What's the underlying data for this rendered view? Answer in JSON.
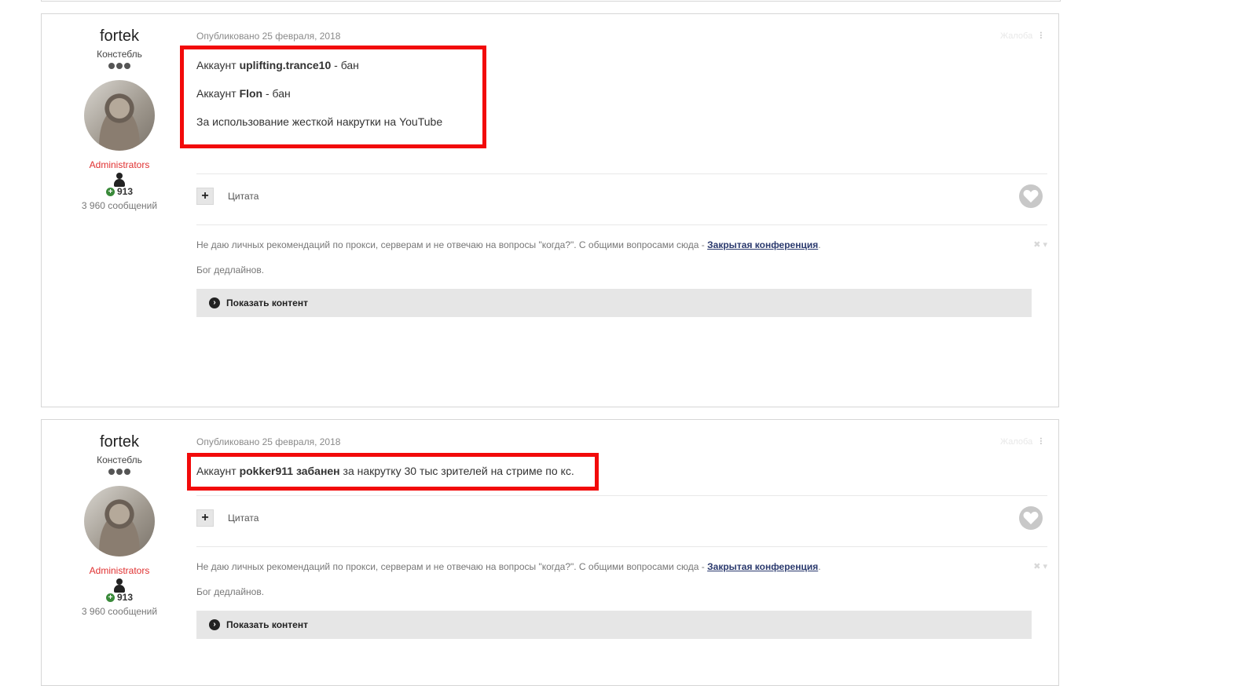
{
  "posts": [
    {
      "author": {
        "name": "fortek",
        "rank": "Констебль",
        "group": "Administrators",
        "reputation": "913",
        "post_count": "3 960 сообщений"
      },
      "date": "Опубликовано 25 февраля, 2018",
      "report_label": "Жалоба",
      "lines": [
        {
          "prefix": "Аккаунт ",
          "bold": "uplifting.trance10",
          "suffix": " - бан"
        },
        {
          "prefix": "Аккаунт ",
          "bold": "Flon",
          "suffix": " - бан"
        },
        {
          "prefix": "За использование жесткой накрутки на YouTube",
          "bold": "",
          "suffix": ""
        }
      ],
      "quote_label": "Цитата",
      "signature": {
        "text": "Не даю личных рекомендаций по прокси, серверам и не отвечаю на вопросы \"когда?\". С общими вопросами сюда - ",
        "link": "Закрытая конференция",
        "after": ".",
        "line2": "Бог дедлайнов."
      },
      "spoiler_label": "Показать контент"
    },
    {
      "author": {
        "name": "fortek",
        "rank": "Констебль",
        "group": "Administrators",
        "reputation": "913",
        "post_count": "3 960 сообщений"
      },
      "date": "Опубликовано 25 февраля, 2018",
      "report_label": "Жалоба",
      "lines": [
        {
          "prefix": "Аккаунт ",
          "bold": "pokker911 забанен",
          "suffix": " за накрутку 30 тыс зрителей на стриме по кс."
        }
      ],
      "quote_label": "Цитата",
      "signature": {
        "text": "Не даю личных рекомендаций по прокси, серверам и не отвечаю на вопросы \"когда?\". С общими вопросами сюда - ",
        "link": "Закрытая конференция",
        "after": ".",
        "line2": "Бог дедлайнов."
      },
      "spoiler_label": "Показать контент"
    }
  ],
  "colors": {
    "highlight_border": "#f20a0a",
    "group_color": "#e03030",
    "link_color": "#2b3a6e"
  }
}
